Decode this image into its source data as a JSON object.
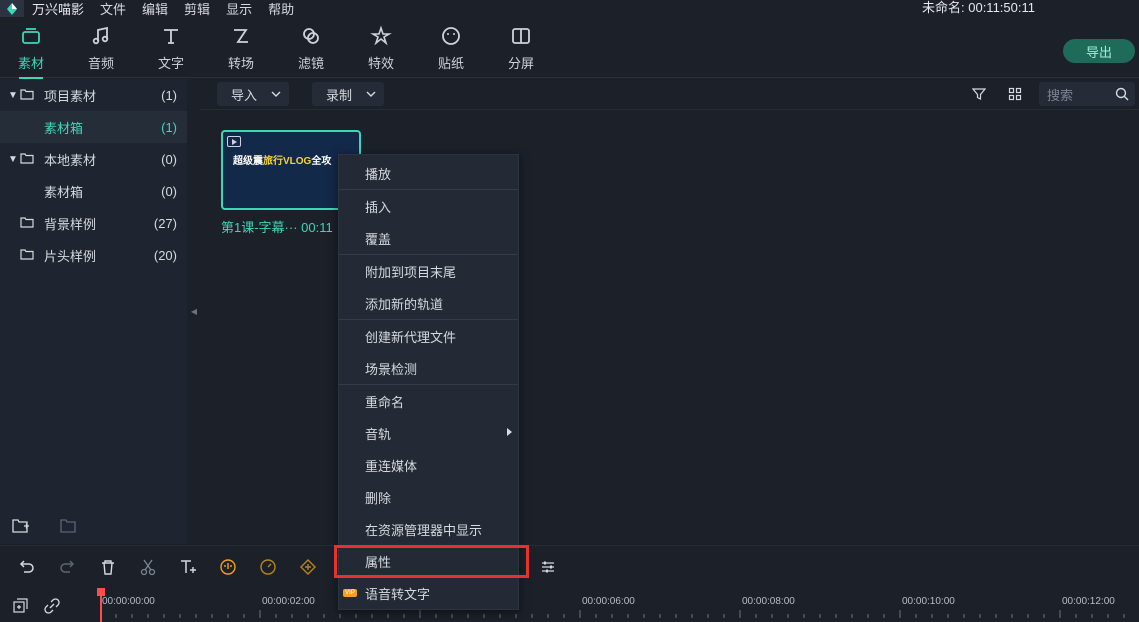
{
  "menubar": {
    "app_name": "万兴喵影",
    "items": [
      "文件",
      "编辑",
      "剪辑",
      "显示",
      "帮助"
    ],
    "project_title": "未命名: 00:11:50:11"
  },
  "toolbar": {
    "tools": [
      {
        "label": "素材",
        "icon": "media-icon",
        "active": true
      },
      {
        "label": "音频",
        "icon": "music-note-icon"
      },
      {
        "label": "文字",
        "icon": "text-icon"
      },
      {
        "label": "转场",
        "icon": "transition-icon"
      },
      {
        "label": "滤镜",
        "icon": "filter-icon"
      },
      {
        "label": "特效",
        "icon": "effects-icon"
      },
      {
        "label": "贴纸",
        "icon": "sticker-icon"
      },
      {
        "label": "分屏",
        "icon": "split-screen-icon"
      }
    ],
    "export_label": "导出"
  },
  "sidebar": {
    "items": [
      {
        "name": "项目素材",
        "count": "(1)",
        "expanded": true
      },
      {
        "name": "素材箱",
        "count": "(1)",
        "selected": true
      },
      {
        "name": "本地素材",
        "count": "(0)",
        "expanded": true
      },
      {
        "name": "素材箱",
        "count": "(0)"
      },
      {
        "name": "背景样例",
        "count": "(27)"
      },
      {
        "name": "片头样例",
        "count": "(20)"
      }
    ]
  },
  "media": {
    "import_label": "导入",
    "record_label": "录制",
    "search_placeholder": "搜索",
    "clip": {
      "caption_pre": "超级震",
      "caption_hl": "旅行VLOG",
      "caption_post": "全攻",
      "label": "第1课-字幕··· 00:11"
    }
  },
  "context_menu": {
    "items": [
      "播放",
      "插入",
      "覆盖",
      "附加到项目末尾",
      "添加新的轨道",
      "创建新代理文件",
      "场景检测",
      "重命名",
      "音轨",
      "重连媒体",
      "删除",
      "在资源管理器中显示",
      "属性",
      "语音转文字"
    ],
    "vip_badge": "VIP",
    "highlighted": "属性"
  },
  "timeline": {
    "labels": [
      "00:00:00:00",
      "00:00:02:00",
      "00:00:06:00",
      "00:00:08:00",
      "00:00:10:00",
      "00:00:12:00"
    ]
  },
  "colors": {
    "accent": "#3fd6b7",
    "highlight_border": "#e6332a",
    "playhead": "#ff4d4f"
  }
}
